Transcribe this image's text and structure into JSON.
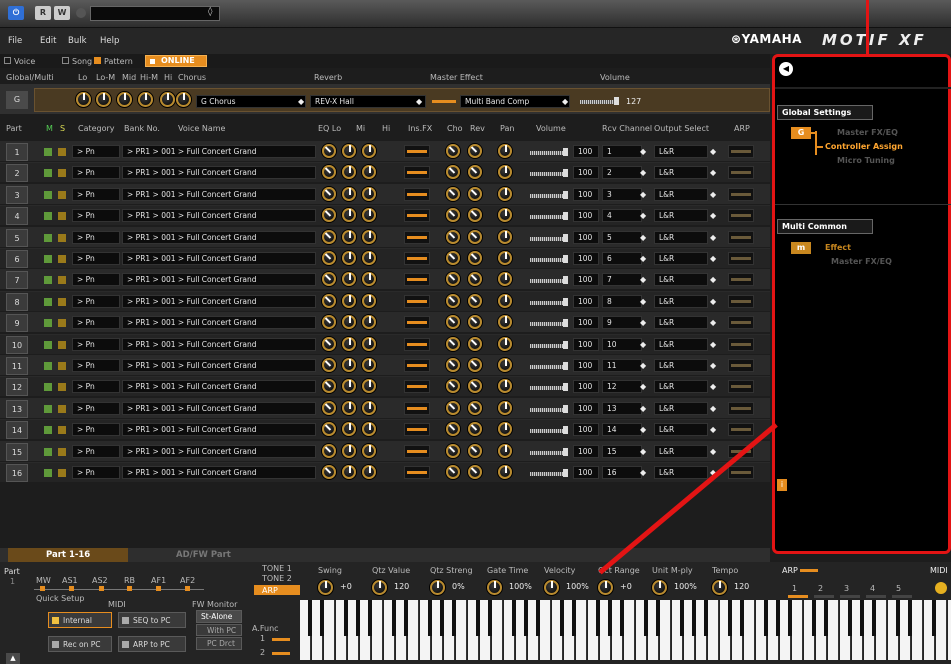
{
  "toolbar": {
    "buttons": [
      "R",
      "W"
    ],
    "field_value": ""
  },
  "menu": [
    "File",
    "Edit",
    "Bulk",
    "Help"
  ],
  "brand": {
    "logo": "YAMAHA",
    "product": "MOTIF XF"
  },
  "modes": {
    "voice": "Voice",
    "song": "Song",
    "pattern": "Pattern",
    "online": "ONLINE"
  },
  "global_header": {
    "global_multi": "Global/Multi",
    "lo": "Lo",
    "lo_m": "Lo-M",
    "mid": "Mid",
    "hi_m": "Hi-M",
    "hi": "Hi",
    "chorus": "Chorus",
    "reverb": "Reverb",
    "master_effect": "Master Effect",
    "volume": "Volume"
  },
  "global_row": {
    "label": "G",
    "chorus_value": "G Chorus",
    "reverb_value": "REV-X Hall",
    "master_effect_value": "Multi Band Comp",
    "volume_value": "127"
  },
  "part_header": {
    "part": "Part",
    "m": "M",
    "s": "S",
    "category": "Category",
    "bank_no": "Bank No.",
    "voice_name": "Voice Name",
    "eq_lo": "EQ Lo",
    "mi": "Mi",
    "hi": "Hi",
    "ins_fx": "Ins.FX",
    "cho": "Cho",
    "rev": "Rev",
    "pan": "Pan",
    "volume": "Volume",
    "rcv_channel": "Rcv Channel",
    "output_select": "Output Select",
    "arp": "ARP"
  },
  "parts": [
    {
      "num": "1",
      "category": "> Pn",
      "voice": "> PR1 > 001 > Full Concert Grand",
      "volume": "100",
      "channel": "1",
      "output": "L&R"
    },
    {
      "num": "2",
      "category": "> Pn",
      "voice": "> PR1 > 001 > Full Concert Grand",
      "volume": "100",
      "channel": "2",
      "output": "L&R"
    },
    {
      "num": "3",
      "category": "> Pn",
      "voice": "> PR1 > 001 > Full Concert Grand",
      "volume": "100",
      "channel": "3",
      "output": "L&R"
    },
    {
      "num": "4",
      "category": "> Pn",
      "voice": "> PR1 > 001 > Full Concert Grand",
      "volume": "100",
      "channel": "4",
      "output": "L&R"
    },
    {
      "num": "5",
      "category": "> Pn",
      "voice": "> PR1 > 001 > Full Concert Grand",
      "volume": "100",
      "channel": "5",
      "output": "L&R"
    },
    {
      "num": "6",
      "category": "> Pn",
      "voice": "> PR1 > 001 > Full Concert Grand",
      "volume": "100",
      "channel": "6",
      "output": "L&R"
    },
    {
      "num": "7",
      "category": "> Pn",
      "voice": "> PR1 > 001 > Full Concert Grand",
      "volume": "100",
      "channel": "7",
      "output": "L&R"
    },
    {
      "num": "8",
      "category": "> Pn",
      "voice": "> PR1 > 001 > Full Concert Grand",
      "volume": "100",
      "channel": "8",
      "output": "L&R"
    },
    {
      "num": "9",
      "category": "> Pn",
      "voice": "> PR1 > 001 > Full Concert Grand",
      "volume": "100",
      "channel": "9",
      "output": "L&R"
    },
    {
      "num": "10",
      "category": "> Pn",
      "voice": "> PR1 > 001 > Full Concert Grand",
      "volume": "100",
      "channel": "10",
      "output": "L&R"
    },
    {
      "num": "11",
      "category": "> Pn",
      "voice": "> PR1 > 001 > Full Concert Grand",
      "volume": "100",
      "channel": "11",
      "output": "L&R"
    },
    {
      "num": "12",
      "category": "> Pn",
      "voice": "> PR1 > 001 > Full Concert Grand",
      "volume": "100",
      "channel": "12",
      "output": "L&R"
    },
    {
      "num": "13",
      "category": "> Pn",
      "voice": "> PR1 > 001 > Full Concert Grand",
      "volume": "100",
      "channel": "13",
      "output": "L&R"
    },
    {
      "num": "14",
      "category": "> Pn",
      "voice": "> PR1 > 001 > Full Concert Grand",
      "volume": "100",
      "channel": "14",
      "output": "L&R"
    },
    {
      "num": "15",
      "category": "> Pn",
      "voice": "> PR1 > 001 > Full Concert Grand",
      "volume": "100",
      "channel": "15",
      "output": "L&R"
    },
    {
      "num": "16",
      "category": "> Pn",
      "voice": "> PR1 > 001 > Full Concert Grand",
      "volume": "100",
      "channel": "16",
      "output": "L&R"
    }
  ],
  "tabs": {
    "part_1_16": "Part 1-16",
    "ad_fw": "AD/FW Part"
  },
  "right_panel": {
    "global_title": "Global Settings",
    "g": "G",
    "global_items": [
      "Master FX/EQ",
      "Controller Assign",
      "Micro Tuning"
    ],
    "multi_title": "Multi Common",
    "m": "m",
    "multi_items": [
      "Effect",
      "Master FX/EQ"
    ],
    "info": "i"
  },
  "bottom": {
    "part_label": "Part",
    "part_num": "1",
    "src": [
      "MW",
      "AS1",
      "AS2",
      "RB",
      "AF1",
      "AF2"
    ],
    "quick_setup": "Quick Setup",
    "midi": "MIDI",
    "fw_monitor": "FW Monitor",
    "buttons": [
      "Internal",
      "SEQ to PC",
      "Rec on PC",
      "ARP to PC"
    ],
    "fw": [
      "St-Alone",
      "With PC",
      "PC Drct"
    ],
    "tones": [
      "TONE 1",
      "TONE 2",
      "ARP"
    ],
    "afunc": "A.Func",
    "afunc_nums": [
      "1",
      "2"
    ],
    "params": [
      {
        "label": "Swing",
        "value": "+0"
      },
      {
        "label": "Qtz Value",
        "value": "120"
      },
      {
        "label": "Qtz Streng",
        "value": "0%"
      },
      {
        "label": "Gate Time",
        "value": "100%"
      },
      {
        "label": "Velocity",
        "value": "100%"
      },
      {
        "label": "Oct Range",
        "value": "+0"
      },
      {
        "label": "Unit M-ply",
        "value": "100%"
      },
      {
        "label": "Tempo",
        "value": "120"
      }
    ],
    "arp_label": "ARP",
    "arp_nums": [
      "1",
      "2",
      "3",
      "4",
      "5"
    ],
    "midi_right": "MIDI"
  }
}
